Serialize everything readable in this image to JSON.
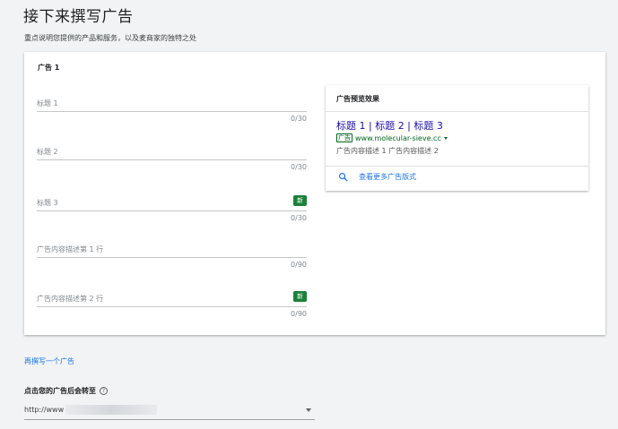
{
  "page": {
    "title": "接下来撰写广告",
    "subtitle": "重点说明您提供的产品和服务，以及麦商家的独特之处"
  },
  "ad": {
    "title": "广告 1",
    "fields": [
      {
        "label": "标题 1",
        "counter": "0/30",
        "badge": ""
      },
      {
        "label": "标题 2",
        "counter": "0/30",
        "badge": ""
      },
      {
        "label": "标题 3",
        "counter": "0/30",
        "badge": "新"
      },
      {
        "label": "广告内容描述第 1 行",
        "counter": "0/90",
        "badge": ""
      },
      {
        "label": "广告内容描述第 2 行",
        "counter": "0/90",
        "badge": "新"
      }
    ]
  },
  "preview": {
    "header": "广告预览效果",
    "headline": "标题 1 | 标题 2 | 标题 3",
    "ad_label": "广告",
    "display_url": "www.molecular-sieve.cc",
    "description": "广告内容描述 1 广告内容描述 2",
    "more_label": "查看更多广告版式"
  },
  "write_another": "再撰写一个广告",
  "destination": {
    "label": "点击您的广告后会转至",
    "help_icon": "?",
    "value": "http://www"
  },
  "colors": {
    "link_blue": "#1a73e8",
    "headline_blue": "#1a0dab",
    "green": "#188038"
  }
}
